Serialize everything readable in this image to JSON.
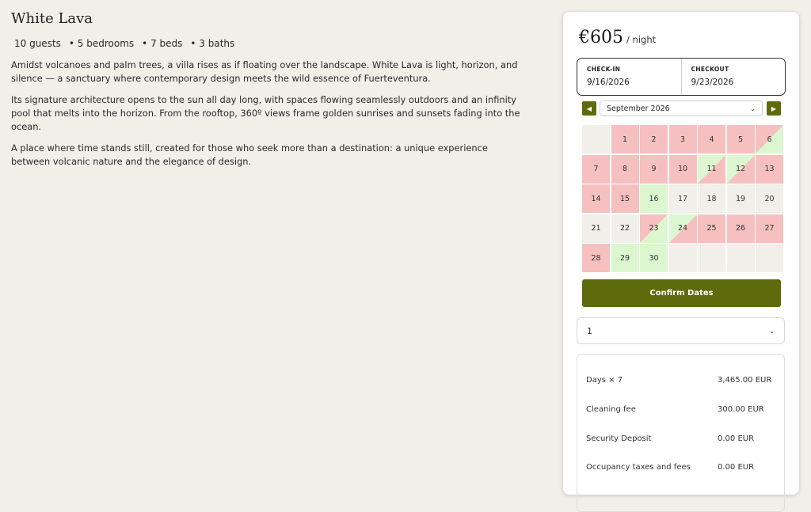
{
  "listing": {
    "title": "White Lava",
    "features": [
      "10 guests",
      "• 5 bedrooms",
      "• 7 beds",
      "• 3 baths"
    ],
    "paragraphs": [
      "Amidst volcanoes and palm trees, a villa rises as if floating over the landscape. White Lava is light, horizon, and silence — a sanctuary where contemporary design meets the wild essence of Fuerteventura.",
      "Its signature architecture opens to the sun all day long, with spaces flowing seamlessly outdoors and an infinity pool that melts into the horizon. From the rooftop, 360º views frame golden sunrises and sunsets fading into the ocean.",
      "A place where time stands still, created for those who seek more than a destination: a unique experience between volcanic nature and the elegance of design."
    ]
  },
  "booking": {
    "price": "€605",
    "price_unit": "/ night",
    "checkin_label": "CHECK-IN",
    "checkin_value": "9/16/2026",
    "checkout_label": "CHECKOUT",
    "checkout_value": "9/23/2026",
    "month": "September 2026",
    "confirm_label": "Confirm Dates",
    "guests_value": "1",
    "breakdown": [
      {
        "label": "Days × 7",
        "amount": "3,465.00 EUR"
      },
      {
        "label": "Cleaning fee",
        "amount": "300.00 EUR"
      },
      {
        "label": "Security Deposit",
        "amount": "0.00 EUR"
      },
      {
        "label": "Occupancy taxes and fees",
        "amount": "0.00 EUR"
      }
    ]
  },
  "calendar": {
    "days": [
      {
        "d": "",
        "s": "empty"
      },
      {
        "d": "1",
        "s": "unavailable"
      },
      {
        "d": "2",
        "s": "unavailable"
      },
      {
        "d": "3",
        "s": "unavailable"
      },
      {
        "d": "4",
        "s": "unavailable"
      },
      {
        "d": "5",
        "s": "unavailable"
      },
      {
        "d": "6",
        "s": "checkout"
      },
      {
        "d": "7",
        "s": "unavailable"
      },
      {
        "d": "8",
        "s": "unavailable"
      },
      {
        "d": "9",
        "s": "unavailable"
      },
      {
        "d": "10",
        "s": "unavailable"
      },
      {
        "d": "11",
        "s": "checkin"
      },
      {
        "d": "12",
        "s": "checkin"
      },
      {
        "d": "13",
        "s": "unavailable"
      },
      {
        "d": "14",
        "s": "unavailable"
      },
      {
        "d": "15",
        "s": "unavailable"
      },
      {
        "d": "16",
        "s": "available"
      },
      {
        "d": "17",
        "s": "neutral"
      },
      {
        "d": "18",
        "s": "neutral"
      },
      {
        "d": "19",
        "s": "neutral"
      },
      {
        "d": "20",
        "s": "neutral"
      },
      {
        "d": "21",
        "s": "neutral"
      },
      {
        "d": "22",
        "s": "neutral"
      },
      {
        "d": "23",
        "s": "checkout"
      },
      {
        "d": "24",
        "s": "checkin"
      },
      {
        "d": "25",
        "s": "unavailable"
      },
      {
        "d": "26",
        "s": "unavailable"
      },
      {
        "d": "27",
        "s": "unavailable"
      },
      {
        "d": "28",
        "s": "unavailable"
      },
      {
        "d": "29",
        "s": "available"
      },
      {
        "d": "30",
        "s": "available"
      },
      {
        "d": "",
        "s": "empty"
      },
      {
        "d": "",
        "s": "empty"
      },
      {
        "d": "",
        "s": "empty"
      },
      {
        "d": "",
        "s": "empty"
      }
    ]
  },
  "colors": {
    "accent": "#5e6b0d",
    "unavailable": "#f6c0c0",
    "available": "#dcf7d0",
    "background": "#f2eee8"
  },
  "icons": {
    "prev": "triangle-left-icon",
    "next": "triangle-right-icon",
    "dropdown": "chevron-down-icon"
  }
}
